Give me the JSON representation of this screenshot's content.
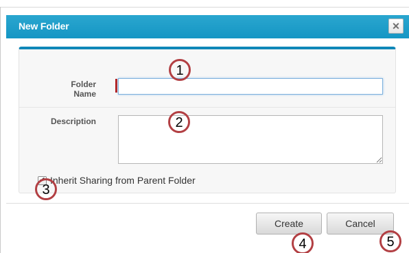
{
  "dialog": {
    "title": "New Folder",
    "close_icon": "close-x-icon"
  },
  "form": {
    "folder_name_label_line1": "Folder",
    "folder_name_label_line2": "Name",
    "folder_name_value": "",
    "description_label": "Description",
    "description_value": "",
    "inherit_checked": true,
    "inherit_label": "Inherit Sharing from Parent Folder"
  },
  "buttons": {
    "create_label": "Create",
    "cancel_label": "Cancel"
  },
  "markers": [
    "1",
    "2",
    "3",
    "4",
    "5"
  ],
  "colors": {
    "titlebar": "#1596c4",
    "panel_accent": "#0f87b8",
    "required_marker": "#b31b1b",
    "callout_circle": "#b23f43"
  }
}
